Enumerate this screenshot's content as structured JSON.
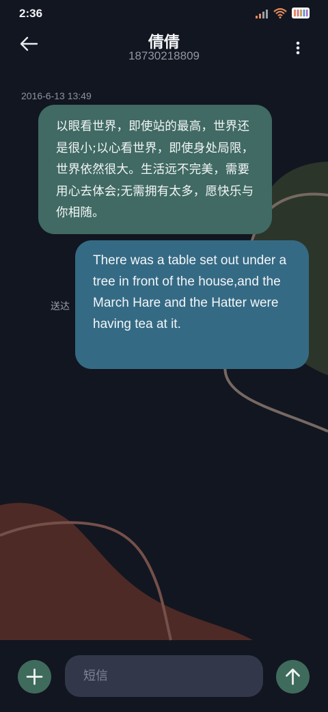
{
  "status_bar": {
    "time": "2:36",
    "signal_icon": "signal-bars-icon",
    "wifi_icon": "wifi-icon",
    "battery_icon": "battery-icon"
  },
  "header": {
    "back_icon": "arrow-left-icon",
    "contact_name": "倩倩",
    "phone_number": "18730218809",
    "more_icon": "more-vertical-icon"
  },
  "conversation": {
    "timestamp": "2016-6-13 13:49",
    "messages": [
      {
        "direction": "incoming",
        "text": "以眼看世界，即使站的最高，世界还是很小;以心看世界，即使身处局限，世界依然很大。生活远不完美，需要用心去体会;无需拥有太多，愿快乐与你相随。"
      },
      {
        "direction": "outgoing",
        "text": "There was a table set out under a tree in front of the house,and the March Hare and the Hatter were having tea at it.",
        "status": "送达"
      }
    ]
  },
  "composer": {
    "add_icon": "plus-icon",
    "placeholder": "短信",
    "value": "",
    "send_icon": "arrow-up-icon"
  },
  "colors": {
    "background": "#121620",
    "incoming_bubble": "#406a63",
    "outgoing_bubble": "#356a84",
    "accent_button": "#3f6b5c",
    "input_background": "#32374a"
  }
}
